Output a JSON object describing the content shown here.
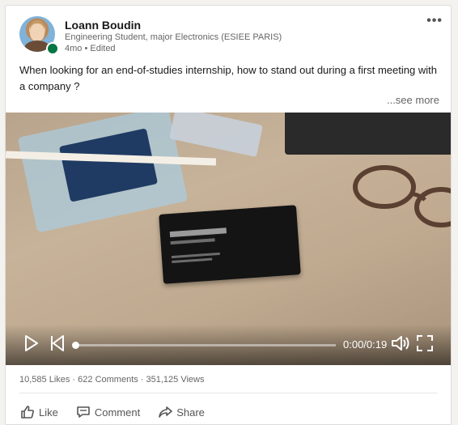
{
  "post": {
    "author": {
      "name": "Loann Boudin",
      "headline": "Engineering Student, major Electronics (ESIEE PARIS)",
      "meta": "4mo • Edited"
    },
    "menu_label": "•••",
    "text": "When looking for an end-of-studies internship, how to stand out during a first meeting with a company ?",
    "see_more": "...see more"
  },
  "video": {
    "time": "0:00/0:19",
    "progress": 0,
    "controls": {
      "play_icon": "play-icon",
      "prev_icon": "skip-back-icon",
      "volume_icon": "volume-icon",
      "fullscreen_icon": "fullscreen-icon"
    }
  },
  "stats": "10,585 Likes · 622 Comments · 351,125 Views",
  "actions": {
    "like": "Like",
    "comment": "Comment",
    "share": "Share"
  },
  "colors": {
    "online": "#057642",
    "text_primary": "#191919",
    "text_secondary": "#666666"
  }
}
